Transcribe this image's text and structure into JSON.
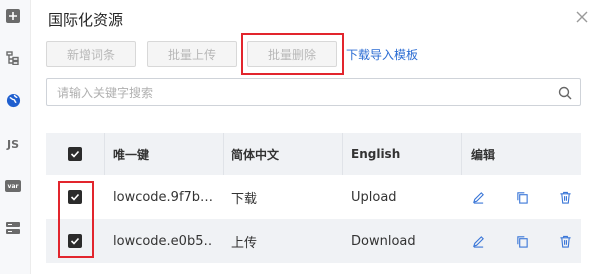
{
  "dialog": {
    "title": "国际化资源",
    "toolbar": {
      "add_label": "新增词条",
      "batch_upload_label": "批量上传",
      "batch_delete_label": "批量删除",
      "download_template_label": "下载导入模板"
    },
    "search": {
      "placeholder": "请输入关键字搜索",
      "value": ""
    }
  },
  "sidebar": {
    "items": [
      {
        "icon": "plus-square-icon"
      },
      {
        "icon": "tree-icon"
      },
      {
        "icon": "globe-icon",
        "active": true
      },
      {
        "icon": "js-icon",
        "label": "JS"
      },
      {
        "icon": "var-icon",
        "label": "var"
      },
      {
        "icon": "database-icon"
      }
    ]
  },
  "table": {
    "headers": {
      "key": "唯一键",
      "zh": "简体中文",
      "en": "English",
      "edit": "编辑"
    },
    "rows": [
      {
        "key": "lowcode.9f7b…",
        "zh": "下载",
        "en": "Upload",
        "checked": true
      },
      {
        "key": "lowcode.e0b5…",
        "zh": "上传",
        "en": "Download",
        "checked": true
      }
    ]
  },
  "colors": {
    "accent": "#2b6cd3",
    "highlight": "#e2252d",
    "header_bg": "#f0f2f5"
  }
}
